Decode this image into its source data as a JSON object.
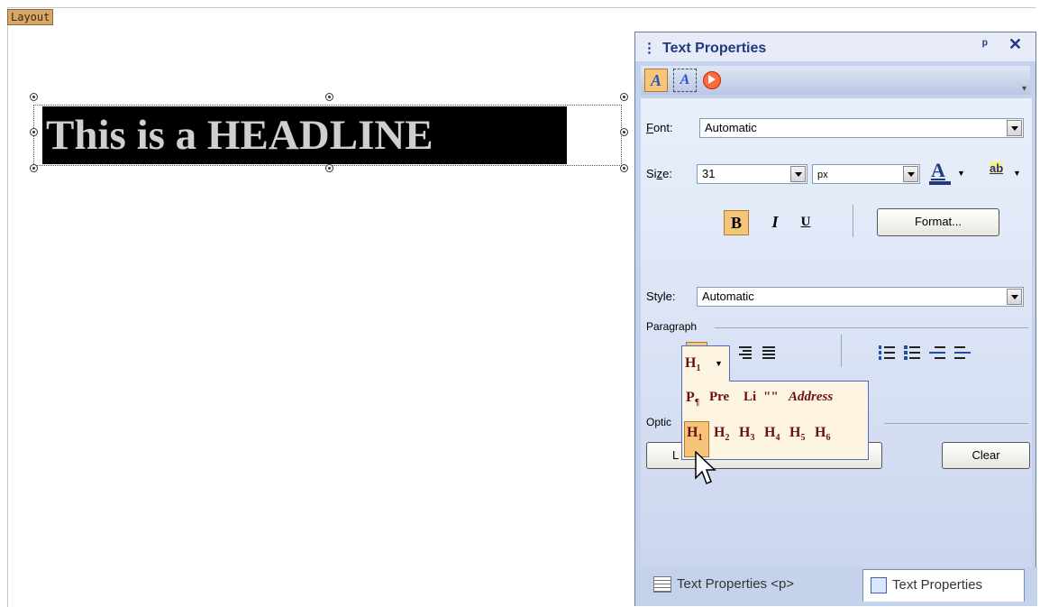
{
  "design_surface": {
    "layout_tag": "Layout",
    "headline_text": "This is a HEADLINE"
  },
  "pane": {
    "title": "Text Properties",
    "pin_icon": "pin-icon",
    "close_label": "✕",
    "toolbar_icons": [
      "text-properties-icon",
      "text-frame-icon",
      "animation-icon"
    ]
  },
  "font": {
    "label_prefix": "",
    "label_accel": "F",
    "label_rest": "ont:",
    "value": "Automatic"
  },
  "size": {
    "label_accel": "Si",
    "label_under": "z",
    "label_rest": "e:",
    "value": "31",
    "unit": "px",
    "font_color": "#1f3a80",
    "highlight_color": "#f5ef8c",
    "highlight_label": "ab",
    "text_color_label": "A"
  },
  "formatting": {
    "bold": "B",
    "italic": "I",
    "underline": "U",
    "format_button": "Format..."
  },
  "style": {
    "label": "Style:",
    "value": "Automatic"
  },
  "paragraph": {
    "label": "Paragraph",
    "alignment_selected": "left"
  },
  "heading_selector": {
    "current": "H1",
    "row1": [
      "P",
      "Pre",
      "Li",
      "\"\"",
      "Address"
    ],
    "row2": [
      "H1",
      "H2",
      "H3",
      "H4",
      "H5",
      "H6"
    ]
  },
  "options": {
    "label": "Optic",
    "left_button": "L",
    "clear_button": "Clear"
  },
  "tabs": [
    {
      "label": "Text Properties <p>",
      "selected": false
    },
    {
      "label": "Text Properties",
      "selected": true
    }
  ]
}
